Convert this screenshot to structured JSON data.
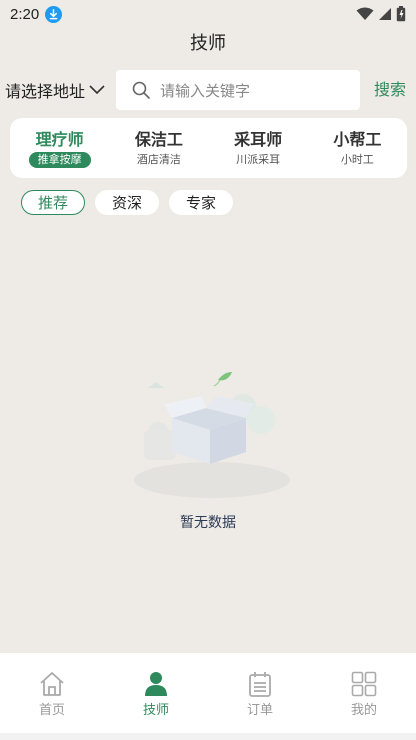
{
  "status": {
    "time": "2:20"
  },
  "nav": {
    "title": "技师"
  },
  "search": {
    "location_label": "请选择地址",
    "placeholder": "请输入关键字",
    "button_label": "搜索"
  },
  "categories": [
    {
      "label": "理疗师",
      "sub": "推拿按摩",
      "active": true
    },
    {
      "label": "保洁工",
      "sub": "酒店清洁",
      "active": false
    },
    {
      "label": "采耳师",
      "sub": "川派采耳",
      "active": false
    },
    {
      "label": "小帮工",
      "sub": "小时工",
      "active": false
    }
  ],
  "filters": [
    {
      "label": "推荐",
      "active": true
    },
    {
      "label": "资深",
      "active": false
    },
    {
      "label": "专家",
      "active": false
    }
  ],
  "empty": {
    "text": "暂无数据"
  },
  "tabs": [
    {
      "label": "首页",
      "icon": "home-icon",
      "active": false
    },
    {
      "label": "技师",
      "icon": "person-icon",
      "active": true
    },
    {
      "label": "订单",
      "icon": "order-icon",
      "active": false
    },
    {
      "label": "我的",
      "icon": "grid-icon",
      "active": false
    }
  ],
  "colors": {
    "accent": "#2e8a5c",
    "background": "#eeeae5"
  }
}
